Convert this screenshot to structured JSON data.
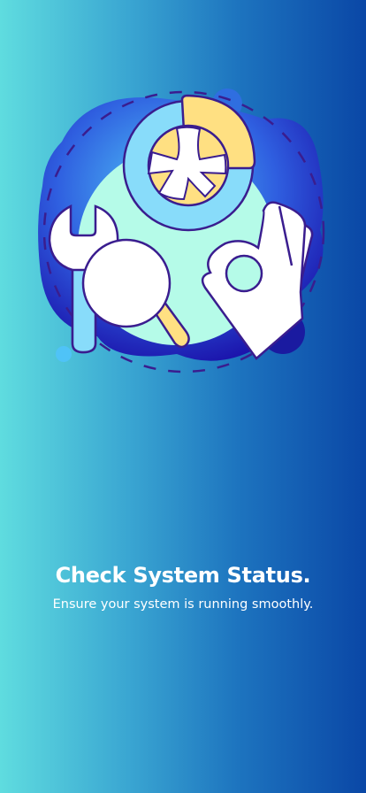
{
  "onboarding": {
    "illustration": "system-check-illustration",
    "title": "Check System Status.",
    "subtitle": "Ensure your system is running smoothly."
  },
  "colors": {
    "gradient_start": "#5fdcdf",
    "gradient_end": "#0a47a6",
    "outline": "#3a1d8f",
    "accent_yellow": "#ffe082",
    "mint": "#b5fbe8",
    "light_blue": "#88dcfa"
  }
}
